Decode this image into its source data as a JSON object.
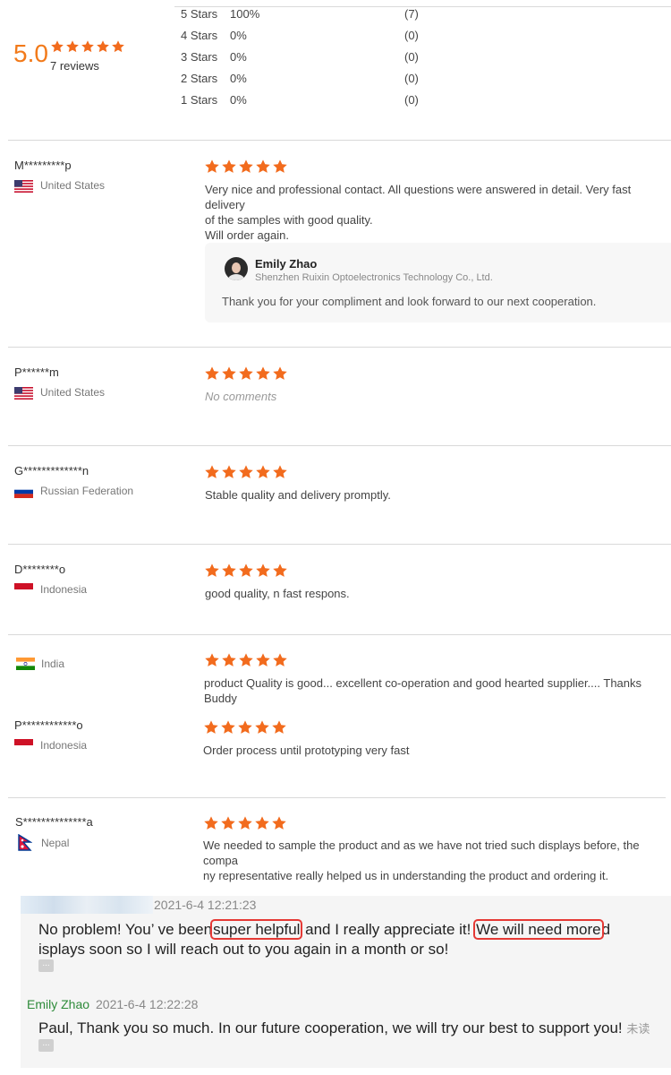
{
  "summary": {
    "score": "5.0",
    "reviews": "7 reviews",
    "distribution": [
      {
        "label": "5 Stars",
        "percent": "100%",
        "count": "(7)"
      },
      {
        "label": "4 Stars",
        "percent": "0%",
        "count": "(0)"
      },
      {
        "label": "3 Stars",
        "percent": "0%",
        "count": "(0)"
      },
      {
        "label": "2 Stars",
        "percent": "0%",
        "count": "(0)"
      },
      {
        "label": "1 Stars",
        "percent": "0%",
        "count": "(0)"
      }
    ]
  },
  "colors": {
    "star": "#f26b1d",
    "score": "#f27a1a",
    "highlight_box": "#e53935",
    "sender_name": "#2e8b3a"
  },
  "reviews": [
    {
      "name": "M*********p",
      "country": "United States",
      "stars": 5,
      "text_lines": [
        "Very nice and professional contact. All questions were answered in detail. Very fast delivery",
        "of the samples with good quality.",
        "Will order again."
      ]
    },
    {
      "name": "P******m",
      "country": "United States",
      "stars": 5,
      "text_lines": [
        "No comments"
      ]
    },
    {
      "name": "G*************n",
      "country": "Russian Federation",
      "stars": 5,
      "text_lines": [
        "Stable quality and delivery promptly."
      ]
    },
    {
      "name": "D********o",
      "country": "Indonesia",
      "stars": 5,
      "text_lines": [
        "good quality, n fast respons."
      ]
    },
    {
      "name": "",
      "country": "India",
      "stars": 5,
      "text_lines": [
        "product Quality is good... excellent co-operation and good hearted supplier.... Thanks Buddy"
      ]
    },
    {
      "name": "P************o",
      "country": "Indonesia",
      "stars": 5,
      "text_lines": [
        "Order process until prototyping very fast"
      ]
    },
    {
      "name": "S**************a",
      "country": "Nepal",
      "stars": 5,
      "text_lines": [
        "We needed to sample the product and as we have not tried such displays before, the compa",
        "ny representative really helped us in understanding the product and ordering it."
      ]
    }
  ],
  "seller_reply": {
    "name": "Emily Zhao",
    "company": "Shenzhen Ruixin Optoelectronics Technology Co., Ltd.",
    "text": "Thank you for your compliment and look forward to our next cooperation."
  },
  "chat": {
    "messages": [
      {
        "time": "2021-6-4 12:21:23",
        "line1_parts": [
          "No problem! You’  ve been",
          "super helpful",
          " and I really appreciate it! ",
          "We will need more",
          "d"
        ],
        "line2": "isplays soon so I will reach out to you again in a month or so!"
      },
      {
        "sender": "Emily Zhao",
        "time": "2021-6-4 12:22:28",
        "text": "Paul, Thank you so much. In our future cooperation, we will try our best to support you!",
        "status": "未读"
      }
    ],
    "more_label": "..."
  }
}
